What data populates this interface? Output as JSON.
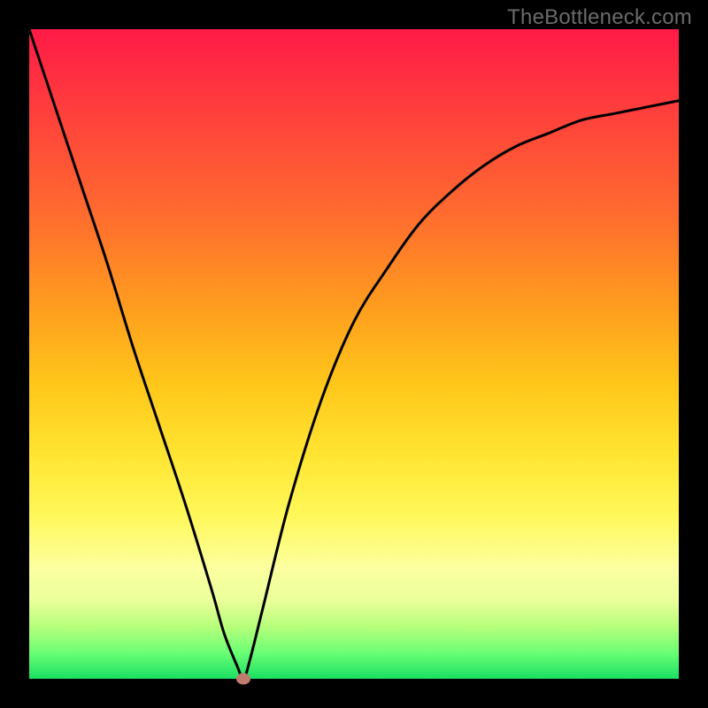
{
  "watermark": "TheBottleneck.com",
  "colors": {
    "frame": "#000000",
    "curve_stroke": "#000000",
    "marker_fill": "#c07a6e",
    "gradient_stops": [
      "#ff1a47",
      "#ff3d3d",
      "#ff6a2f",
      "#ff9a1f",
      "#ffc81a",
      "#ffe633",
      "#fff85a",
      "#fcffa0",
      "#eaff9a",
      "#b6ff7a",
      "#6aff75",
      "#1bdf63"
    ]
  },
  "chart_data": {
    "type": "line",
    "title": "",
    "xlabel": "",
    "ylabel": "",
    "xlim": [
      0,
      100
    ],
    "ylim": [
      0,
      100
    ],
    "grid": false,
    "legend": false,
    "annotations": [
      {
        "text": "TheBottleneck.com",
        "position": "top-right"
      }
    ],
    "series": [
      {
        "name": "bottleneck-curve",
        "x": [
          0,
          4,
          8,
          12,
          16,
          20,
          24,
          28,
          30,
          32,
          33,
          34,
          36,
          40,
          45,
          50,
          55,
          60,
          65,
          70,
          75,
          80,
          85,
          90,
          95,
          100
        ],
        "y": [
          100,
          88,
          76,
          64,
          51,
          39,
          27,
          14,
          7,
          2,
          0,
          3,
          11,
          27,
          43,
          55,
          63,
          70,
          75,
          79,
          82,
          84,
          86,
          87,
          88,
          89
        ]
      }
    ],
    "marker": {
      "x": 33,
      "y": 0
    }
  }
}
